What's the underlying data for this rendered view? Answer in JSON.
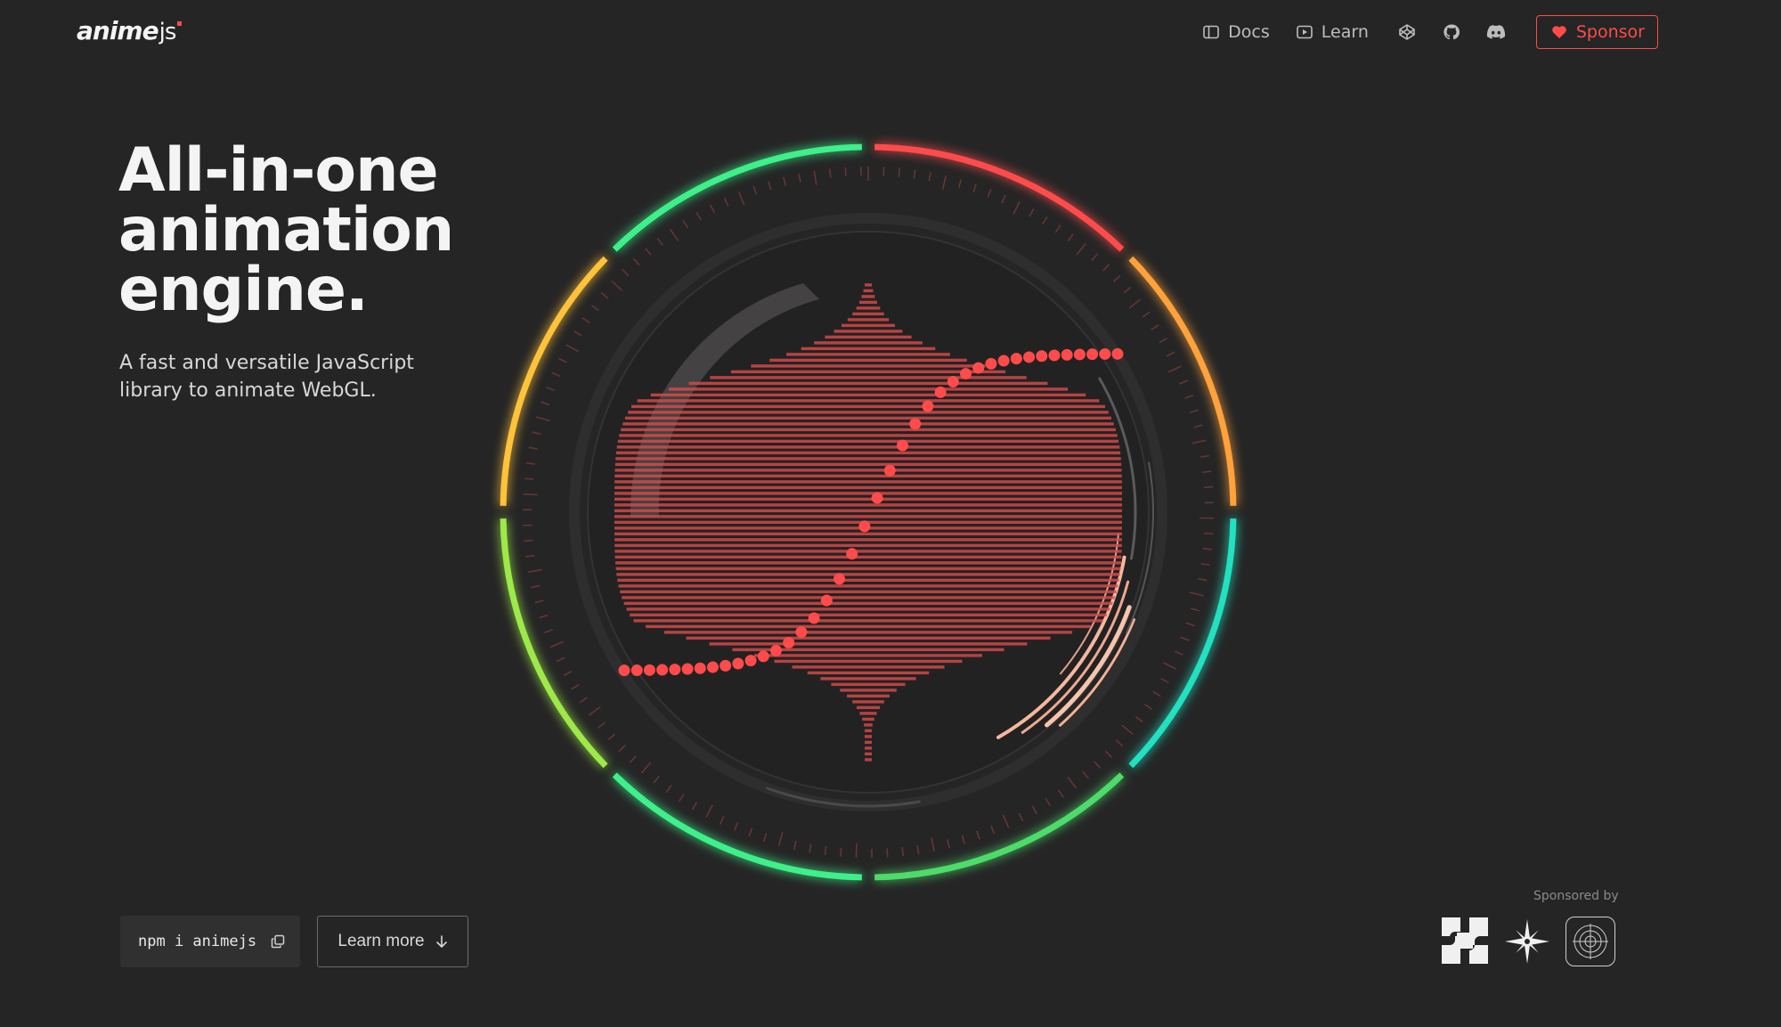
{
  "brand": {
    "name": "anime",
    "suffix": "js"
  },
  "nav": {
    "docs_label": "Docs",
    "learn_label": "Learn",
    "sponsor_label": "Sponsor"
  },
  "hero": {
    "title_lines": [
      "All-in-one",
      "animation",
      "engine."
    ],
    "subtitle_lines": [
      "A fast and versatile JavaScript",
      "library to animate WebGL."
    ]
  },
  "actions": {
    "install_command": "npm i animejs",
    "learn_more_label": "Learn more"
  },
  "sponsors": {
    "label": "Sponsored by"
  },
  "colors": {
    "background": "#252525",
    "accent": "#ff4b4b",
    "text": "#f4f4f4",
    "muted": "#bdbdbd"
  },
  "icons": {
    "docs": "book-icon",
    "learn": "play-icon",
    "codepen": "codepen-icon",
    "github": "github-icon",
    "discord": "discord-icon",
    "sponsor": "heart-icon",
    "copy": "copy-icon",
    "arrow": "arrow-down-icon"
  }
}
